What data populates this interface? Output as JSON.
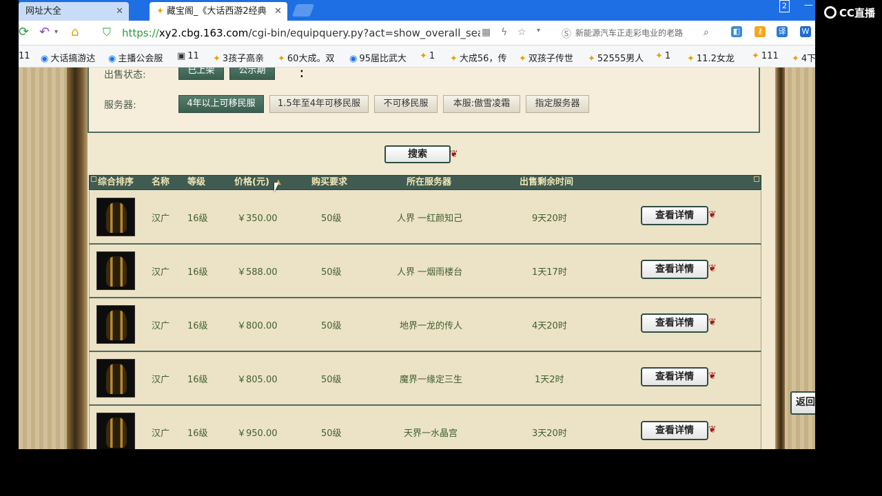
{
  "browser": {
    "tabs": [
      {
        "label": "网址大全",
        "active": false
      },
      {
        "label": "藏宝阁_《大话西游2经典",
        "active": true
      }
    ],
    "window_badge": "2",
    "url_scheme": "https://",
    "url_host": "xy2.cbg.163.com",
    "url_path": "/cgi-bin/equipquery.py?act=show_overall_search",
    "search_box_text": "新能源汽车正走彩电业的老路",
    "bookmarks": [
      "11",
      "大话搞游达",
      "主播公会服",
      "11",
      "3孩子高亲",
      "60大成。双",
      "95届比武大",
      "1",
      "大成56，传",
      "双孩子传世",
      "52555男人",
      "1",
      "11.2女龙",
      "111",
      "4下"
    ]
  },
  "overlay": {
    "cc_logo": "CC直播"
  },
  "filters": {
    "sale_status_label": "出售状态:",
    "sale_status_options": [
      "已上架",
      "公示期"
    ],
    "server_label": "服务器:",
    "server_options": [
      "4年以上可移民服",
      "1.5年至4年可移民服",
      "不可移民服",
      "本服:傲雪凌霜",
      "指定服务器"
    ],
    "server_selected": 0
  },
  "search_button": "搜索",
  "table": {
    "headers": [
      "综合排序",
      "名称",
      "等级",
      "价格(元)",
      "购买要求",
      "所在服务器",
      "出售剩余时间"
    ],
    "sort_icon": "sort-arrow-icon",
    "rows": [
      {
        "name": "汉广",
        "level": "16级",
        "price": "￥350.00",
        "req": "50级",
        "server": "人界 一红颜知己",
        "time": "9天20时",
        "action": "查看详情"
      },
      {
        "name": "汉广",
        "level": "16级",
        "price": "￥588.00",
        "req": "50级",
        "server": "人界 一烟雨楼台",
        "time": "1天17时",
        "action": "查看详情"
      },
      {
        "name": "汉广",
        "level": "16级",
        "price": "￥800.00",
        "req": "50级",
        "server": "地界一龙的传人",
        "time": "4天20时",
        "action": "查看详情"
      },
      {
        "name": "汉广",
        "level": "16级",
        "price": "￥805.00",
        "req": "50级",
        "server": "魔界一缘定三生",
        "time": "1天2时",
        "action": "查看详情"
      },
      {
        "name": "汉广",
        "level": "16级",
        "price": "￥950.00",
        "req": "50级",
        "server": "天界一水晶宫",
        "time": "3天20时",
        "action": "查看详情"
      }
    ]
  },
  "back_button": "返回"
}
